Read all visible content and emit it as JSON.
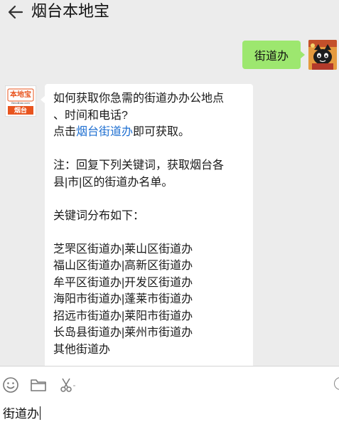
{
  "header": {
    "title": "烟台本地宝"
  },
  "user_message": {
    "text": "街道办"
  },
  "bot_message": {
    "lines": [
      "如何获取你急需的街道办办公地点",
      "、时间和电话?"
    ],
    "click_prefix": "点击",
    "link_text": "烟台街道办",
    "click_suffix": "即可获取。",
    "note_lines": [
      "注：回复下列关键词，获取烟台各",
      "县|市|区的街道办名单。"
    ],
    "keywords_heading": "关键词分布如下：",
    "keywords": [
      "芝罘区街道办|莱山区街道办",
      "福山区街道办|高新区街道办",
      "牟平区街道办|开发区街道办",
      "海阳市街道办|蓬莱市街道办",
      "招远市街道办|莱阳市街道办",
      "长岛县街道办|莱州市街道办",
      "其他街道办"
    ]
  },
  "bot_avatar": {
    "logo_text": "本地宝",
    "domain_text": "Bendibao.com",
    "city_label": "烟台"
  },
  "input": {
    "value": "街道办"
  },
  "colors": {
    "user_bubble": "#9de76f",
    "link": "#1e6fd1",
    "logo_orange": "#e8541e"
  }
}
